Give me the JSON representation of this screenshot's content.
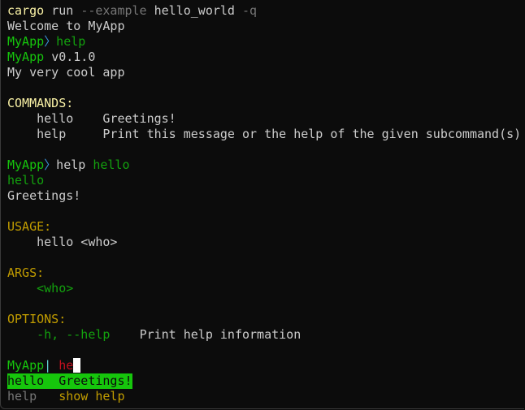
{
  "terminal": {
    "colors": {
      "background": "#0c0c0c",
      "foreground": "#cccccc",
      "green": "#13a10e",
      "bright_green": "#16c60c",
      "yellow": "#c19c00",
      "bright_yellow": "#f9f1a5",
      "red": "#c50f1f",
      "gray": "#767676"
    },
    "command": {
      "program": "cargo",
      "sub": "run",
      "flag": "--example",
      "arg": "hello_world",
      "quiet": "-q"
    },
    "welcome": "Welcome to MyApp",
    "prompt": {
      "name": "MyApp",
      "separator_icon": "〉",
      "active_separator": "|"
    },
    "session1": {
      "input": "help",
      "app_name": "MyApp",
      "version": "v0.1.0",
      "description": "My very cool app",
      "commands_header": "COMMANDS:",
      "commands": [
        {
          "name": "hello",
          "desc": "Greetings!"
        },
        {
          "name": "help",
          "desc": "Print this message or the help of the given subcommand(s)"
        }
      ]
    },
    "session2": {
      "input_cmd": "help",
      "input_arg": "hello",
      "name": "hello",
      "about": "Greetings!",
      "usage_header": "USAGE:",
      "usage": "hello <who>",
      "args_header": "ARGS:",
      "args": [
        "<who>"
      ],
      "options_header": "OPTIONS:",
      "options": [
        {
          "flag": "-h, --help",
          "desc": "Print help information"
        }
      ]
    },
    "current": {
      "typed": "he",
      "completions": [
        {
          "name": "hello",
          "desc": "Greetings!",
          "selected": true
        },
        {
          "name": "help",
          "desc": "show help",
          "selected": false
        }
      ]
    }
  }
}
